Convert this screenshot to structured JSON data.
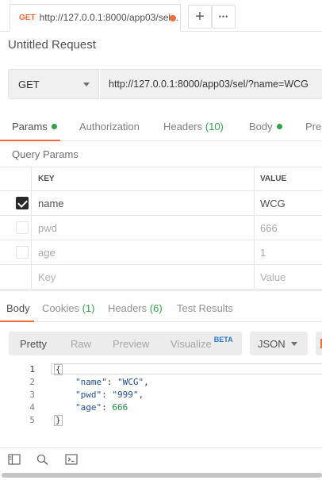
{
  "tab": {
    "method": "GET",
    "url": "http://127.0.0.1:8000/app03/sel..."
  },
  "strip": {
    "new_tab_glyph": "+",
    "more_glyph": "•••"
  },
  "title": "Untitled Request",
  "request": {
    "method": "GET",
    "url": "http://127.0.0.1:8000/app03/sel/?name=WCG"
  },
  "req_tabs": {
    "params": "Params",
    "authorization": "Authorization",
    "headers": "Headers",
    "headers_count": "(10)",
    "body": "Body",
    "pre": "Pre"
  },
  "query_params": {
    "label": "Query Params",
    "col_key": "KEY",
    "col_value": "VALUE",
    "rows": [
      {
        "key": "name",
        "value": "WCG",
        "checked": true
      },
      {
        "key": "pwd",
        "value": "666",
        "checked": false
      },
      {
        "key": "age",
        "value": "1",
        "checked": false
      }
    ],
    "key_placeholder": "Key",
    "value_placeholder": "Value"
  },
  "resp_tabs": {
    "body": "Body",
    "cookies": "Cookies",
    "cookies_count": "(1)",
    "headers": "Headers",
    "headers_count": "(6)",
    "tests": "Test Results"
  },
  "view": {
    "pretty": "Pretty",
    "raw": "Raw",
    "preview": "Preview",
    "visualize": "Visualize",
    "beta": "BETA",
    "format": "JSON"
  },
  "code": {
    "line_numbers": [
      "1",
      "2",
      "3",
      "4",
      "5"
    ],
    "open": "{",
    "close": "}",
    "fields": [
      {
        "key": "\"name\"",
        "value": "\"WCG\"",
        "trail": ","
      },
      {
        "key": "\"pwd\"",
        "value": "\"999\"",
        "trail": ","
      },
      {
        "key": "\"age\"",
        "value": "666",
        "trail": ""
      }
    ]
  },
  "icons": [
    "sidebar-icon",
    "find-icon",
    "console-icon"
  ],
  "colors": {
    "accent": "#f26b3a",
    "success": "#2fa34b",
    "info": "#2c76c7"
  }
}
